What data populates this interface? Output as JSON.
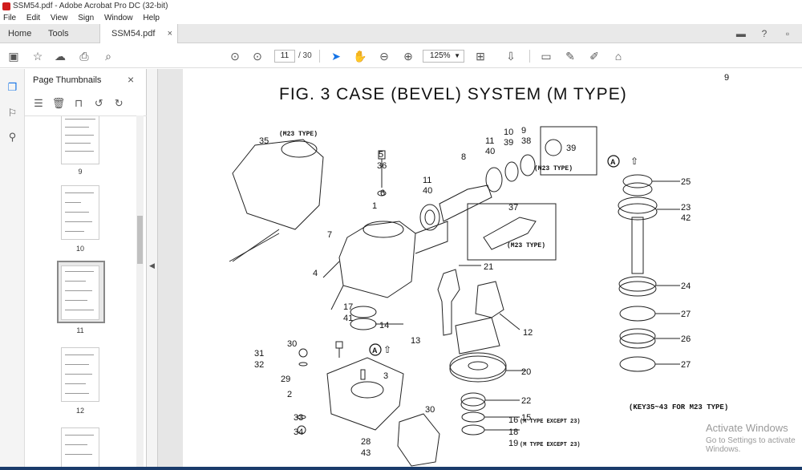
{
  "window": {
    "title": "SSM54.pdf - Adobe Acrobat Pro DC (32-bit)"
  },
  "menu": [
    "File",
    "Edit",
    "View",
    "Sign",
    "Window",
    "Help"
  ],
  "tabs": {
    "home": "Home",
    "tools": "Tools",
    "document": "SSM54.pdf",
    "close": "×"
  },
  "toolbar": {
    "current_page": "11",
    "page_total": "/ 30",
    "zoom": "125%"
  },
  "thumbnails_panel": {
    "title": "Page Thumbnails",
    "close": "×",
    "pages": [
      {
        "label": "9"
      },
      {
        "label": "10"
      },
      {
        "label": "11",
        "selected": true
      },
      {
        "label": "12"
      }
    ]
  },
  "document": {
    "page_number": "9",
    "figure_title": "FIG.  3    CASE (BEVEL) SYSTEM (M TYPE)",
    "note": "(KEY35~43 FOR M23 TYPE)",
    "inset_labels": {
      "m23_top": "(M23 TYPE)",
      "m23_ring": "(M23 TYPE)",
      "m23_shaft": "(M23 TYPE)"
    },
    "callouts": {
      "c35": "35",
      "c5": "5",
      "c36": "36",
      "c6": "6",
      "c1": "1",
      "c7": "7",
      "c4": "4",
      "c11a": "11",
      "c40a": "40",
      "c8": "8",
      "c11b": "11",
      "c40b": "40",
      "c10": "10",
      "c39a": "39",
      "c9": "9",
      "c38": "38",
      "c39b": "39",
      "c37": "37",
      "c21": "21",
      "c17": "17",
      "c41": "41",
      "c14": "14",
      "c13": "13",
      "c12": "12",
      "c30a": "30",
      "c31": "31",
      "c32": "32",
      "c29": "29",
      "c3": "3",
      "c2": "2",
      "c20": "20",
      "c22": "22",
      "c15": "15",
      "c16": "16",
      "c18": "18",
      "c19": "19",
      "c30b": "30",
      "c33": "33",
      "c34": "34",
      "c28": "28",
      "c43": "43",
      "c25": "25",
      "c23": "23",
      "c42": "42",
      "c24": "24",
      "c27a": "27",
      "c26": "26",
      "c27b": "27",
      "a1": "A",
      "a2": "A"
    },
    "side_notes": {
      "m_except_16": "(M TYPE EXCEPT 23)",
      "m_except_19": "(M TYPE EXCEPT 23)"
    }
  },
  "watermark": {
    "line1": "Activate Windows",
    "line2": "Go to Settings to activate Windows."
  }
}
